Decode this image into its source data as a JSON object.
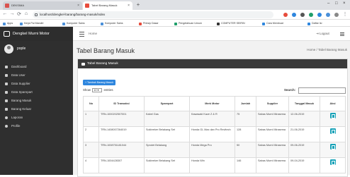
{
  "browser": {
    "tabs": [
      {
        "label": "DEKSIMA"
      },
      {
        "label": "Tabel Barang Masuk"
      }
    ],
    "url": "localhost/dengkel-barang/barang-masuk/index",
    "bookmarks": [
      "Apps",
      "Kerja Pai Mandiri",
      "Komputer Sains",
      "Komputer Sains",
      "Prinsip Dasar",
      "Pengetahuan Umum",
      "COMPUTER SEIRIN",
      "Cara Membuat",
      "Daftar Isi"
    ]
  },
  "header": {
    "brand": "Dengkel Murni Motor",
    "home": "Home",
    "logout": "Logout"
  },
  "sidebar": {
    "username": "pople",
    "items": [
      {
        "label": "Dashboard"
      },
      {
        "label": "Data User"
      },
      {
        "label": "Data Supplier"
      },
      {
        "label": "Data Sparepart"
      },
      {
        "label": "Barang Masuk"
      },
      {
        "label": "Barang Keluar"
      },
      {
        "label": "Laporan"
      },
      {
        "label": "Profile"
      }
    ]
  },
  "page": {
    "title": "Tabel Barang Masuk",
    "breadcrumb": "Home / Tabel Barang Masuk",
    "panel_title": "Tabel Barang Masuk",
    "add_button": "+ Tambah Barang Masuk",
    "show_prefix": "Show",
    "show_value": "10",
    "show_suffix": "entries",
    "search_label": "Search:",
    "search_value": ""
  },
  "table": {
    "headers": [
      "No",
      "ID Transaksi",
      "Sparepart",
      "Merk Motor",
      "Jumlah",
      "Supplier",
      "Tanggal Masuk",
      "Aksi"
    ],
    "rows": [
      {
        "no": "1",
        "id": "TRN-1000202507001",
        "sparepart": "Kabel Gas",
        "merk": "Kawasaki Kaze Z & R",
        "jumlah": "75",
        "supplier": "Sabas Murni Mirasema",
        "tanggal": "12-06-2019"
      },
      {
        "no": "2",
        "id": "TRN-1408007264019",
        "sparepart": "Sokbreker Belakang Set",
        "merk": "Honda GL Max dan Pro Revitech",
        "jumlah": "128",
        "supplier": "Sabas Murni Mirasema",
        "tanggal": "21-06-2019"
      },
      {
        "no": "3",
        "id": "TRN-1008751181044",
        "sparepart": "Sprotet Belakang",
        "merk": "Honda Mega Pro",
        "jumlah": "50",
        "supplier": "Sabas Murni Mirasema",
        "tanggal": "09-06-2019"
      },
      {
        "no": "4",
        "id": "TRN-1004428307",
        "sparepart": "Sokbreker Belakang Set",
        "merk": "Honda Win",
        "jumlah": "146",
        "supplier": "Sabas Murni Mirasema",
        "tanggal": "09-04-2019"
      }
    ]
  },
  "colors": {
    "sidebar": "#2f2f2f",
    "panel_header": "#3a3a3a",
    "primary_button": "#2e86de",
    "action_button": "#17a2b8"
  }
}
